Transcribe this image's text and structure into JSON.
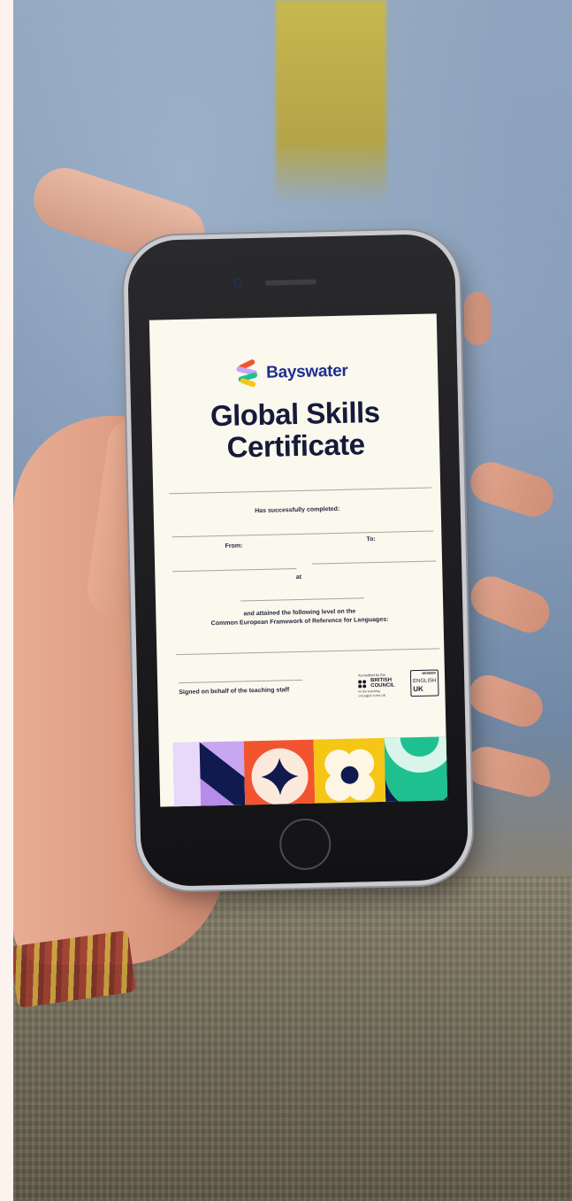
{
  "certificate": {
    "brand": "Bayswater",
    "title_line1": "Global Skills",
    "title_line2": "Certificate",
    "completed_label": "Has successfully completed:",
    "from_label": "From:",
    "to_label": "To:",
    "at_label": "at",
    "level_line1": "and attained the following level on the",
    "level_line2": "Common European Framework of Reference for Languages:",
    "signature_label": "Signed on behalf of the teaching staff",
    "accreditation": {
      "top": "Accredited by the",
      "org_line1": "BRITISH",
      "org_line2": "COUNCIL",
      "bottom_line1": "for the teaching",
      "bottom_line2": "of English in the UK"
    },
    "english_uk": {
      "member": "MEMBER",
      "english": "ENGLISH",
      "uk": "UK"
    }
  },
  "colors": {
    "brand_navy": "#1d2f8f",
    "title_ink": "#161a3a",
    "paper": "#fbf8ee",
    "tile_purple": "#c7a6f2",
    "tile_orange": "#f25430",
    "tile_yellow": "#f6c616",
    "tile_green": "#1fc08f",
    "tile_navy": "#101a4f"
  },
  "icons": [
    "bayswater-logo-icon",
    "british-council-logo-icon",
    "english-uk-logo-icon",
    "star-tile-icon",
    "flower-tile-icon",
    "arches-tile-icon",
    "chevron-tile-icon"
  ]
}
